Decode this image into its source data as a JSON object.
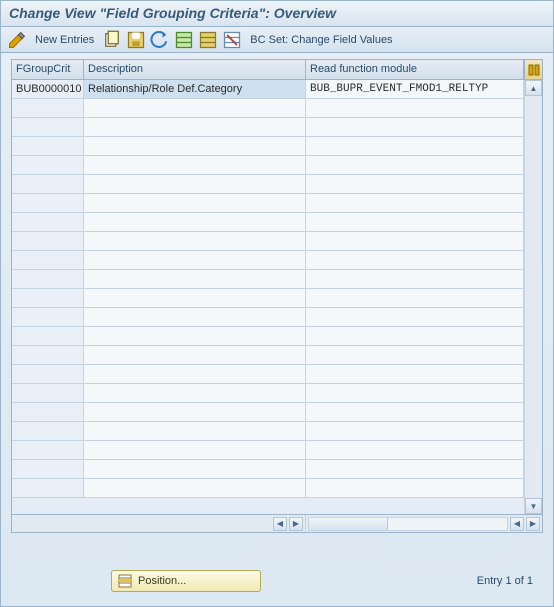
{
  "title": "Change View \"Field Grouping Criteria\": Overview",
  "toolbar": {
    "new_entries": "New Entries",
    "bcset_label": "BC Set: Change Field Values"
  },
  "grid": {
    "columns": [
      "FGroupCrit",
      "Description",
      "Read function module"
    ],
    "rows": [
      {
        "crit": "BUB0000010",
        "desc": "Relationship/Role Def.Category",
        "func": "BUB_BUPR_EVENT_FMOD1_RELTYP"
      }
    ],
    "empty_rows": 21
  },
  "footer": {
    "position_label": "Position...",
    "entry_text": "Entry 1 of 1"
  },
  "icons": {
    "pencil": "pencil-icon",
    "copy": "copy-icon",
    "save_row": "save-row-icon",
    "undo": "undo-icon",
    "select_all": "select-all-icon",
    "save_table": "save-table-icon",
    "delete_row": "delete-row-icon",
    "config": "config-columns-icon",
    "position": "position-icon"
  }
}
